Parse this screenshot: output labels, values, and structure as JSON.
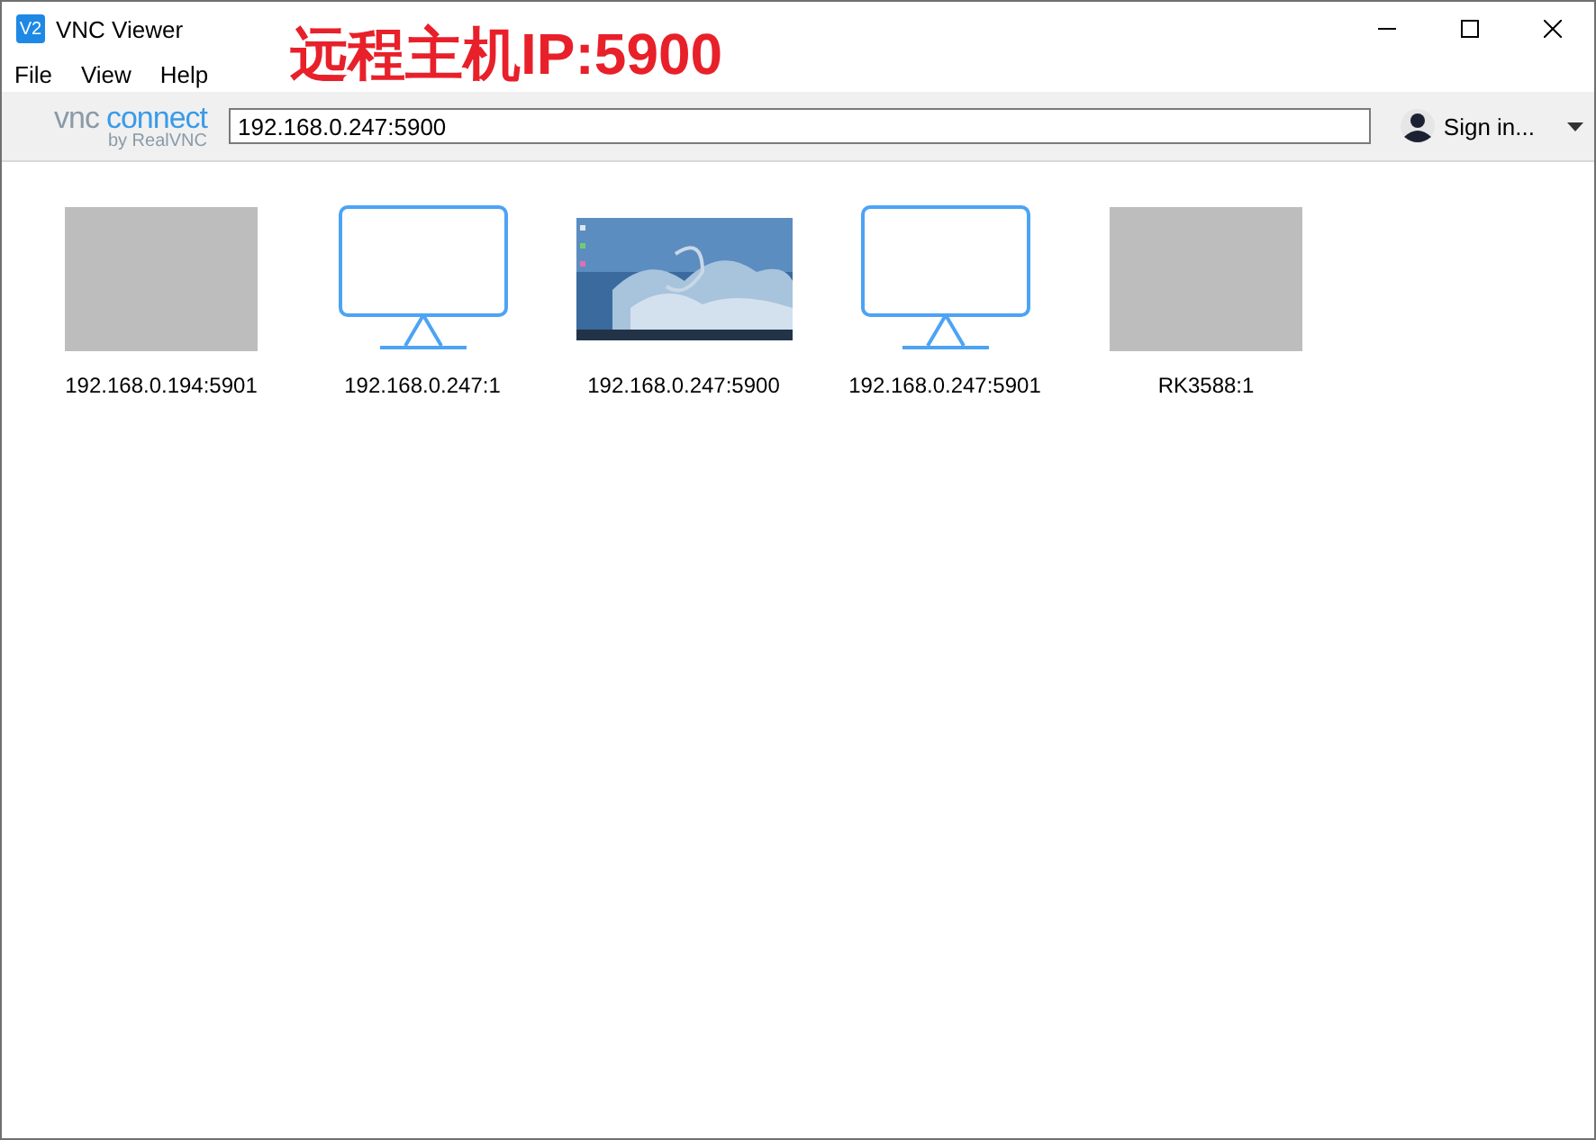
{
  "window": {
    "title": "VNC Viewer",
    "app_icon": "V2"
  },
  "annotation": "远程主机IP:5900",
  "menu": [
    "File",
    "View",
    "Help"
  ],
  "toolbar": {
    "logo": {
      "vnc": "vnc",
      "connect": "connect",
      "by": "by RealVNC"
    },
    "address": "192.168.0.247:5900",
    "sign_in": "Sign in..."
  },
  "connections": [
    {
      "kind": "blank",
      "label": "192.168.0.194:5901"
    },
    {
      "kind": "monitor",
      "label": "192.168.0.247:1"
    },
    {
      "kind": "picture",
      "label": "192.168.0.247:5900"
    },
    {
      "kind": "monitor",
      "label": "192.168.0.247:5901"
    },
    {
      "kind": "blank",
      "label": "RK3588:1"
    }
  ]
}
